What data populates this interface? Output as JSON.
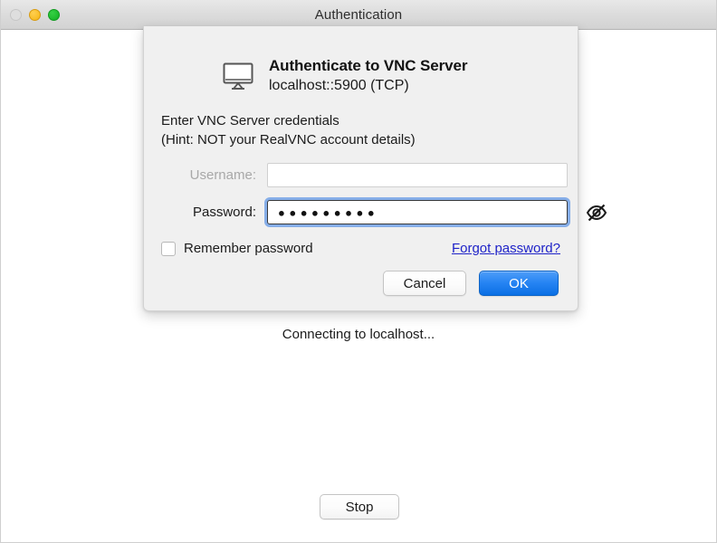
{
  "window": {
    "title": "Authentication",
    "traffic_lights": [
      {
        "name": "close",
        "color": "#dedede",
        "enabled": false
      },
      {
        "name": "minimize",
        "color": "#f5b514",
        "enabled": true
      },
      {
        "name": "maximize",
        "color": "#13b023",
        "enabled": true
      }
    ]
  },
  "background": {
    "status_text": "Connecting to localhost...",
    "stop_button_label": "Stop"
  },
  "dialog": {
    "icon": "monitor-icon",
    "title": "Authenticate to VNC Server",
    "subtitle": "localhost::5900 (TCP)",
    "instructions_line1": "Enter VNC Server credentials",
    "instructions_line2": "(Hint: NOT your RealVNC account details)",
    "username": {
      "label": "Username:",
      "value": "",
      "placeholder": "",
      "disabled": true
    },
    "password": {
      "label": "Password:",
      "value": "●●●●●●●●●",
      "masked_char_count": 9,
      "placeholder": "",
      "focused": true,
      "reveal_icon": "eye-slash-icon"
    },
    "remember": {
      "label": "Remember password",
      "checked": false
    },
    "forgot_link": "Forgot password?",
    "buttons": {
      "cancel": "Cancel",
      "ok": "OK"
    },
    "colors": {
      "focus_ring": "#86aee8",
      "link": "#1f23c8",
      "primary_button": "#2684f3",
      "dialog_background": "#f0f0f0"
    }
  }
}
